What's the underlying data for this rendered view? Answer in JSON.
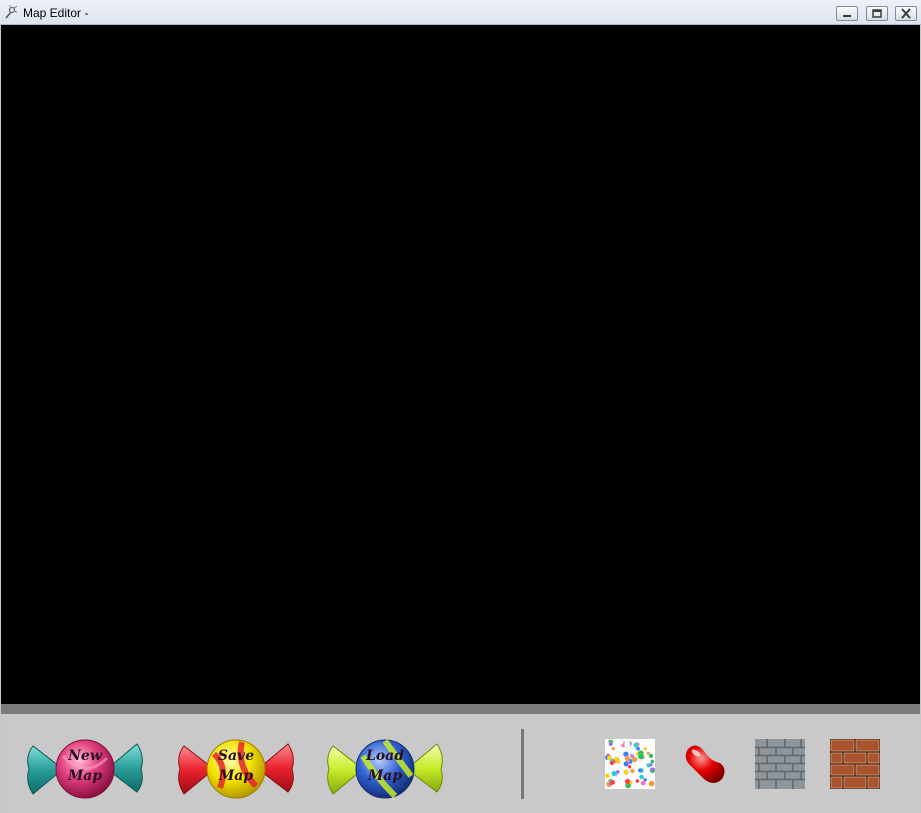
{
  "window": {
    "title": "Map Editor -",
    "controls": [
      "minimize",
      "restore",
      "close"
    ]
  },
  "toolbar": {
    "new_map": {
      "line1": "New",
      "line2": "Map"
    },
    "save_map": {
      "line1": "Save",
      "line2": "Map"
    },
    "load_map": {
      "line1": "Load",
      "line2": "Map"
    }
  },
  "palette": {
    "tiles": [
      "sprinkles-tile",
      "jellybean-tile",
      "gray-brick-tile",
      "brown-brick-tile"
    ]
  },
  "colors": {
    "canvas": "#000000",
    "toolbar": "#c9c9c9",
    "new_map_wrapper": "#2a9d9a",
    "new_map_ball": "#d6336c",
    "save_map_wrapper": "#e8222e",
    "save_map_ball": "#f2e200",
    "load_map_wrapper": "#c6ec2a",
    "load_map_ball": "#2f5fd0"
  }
}
